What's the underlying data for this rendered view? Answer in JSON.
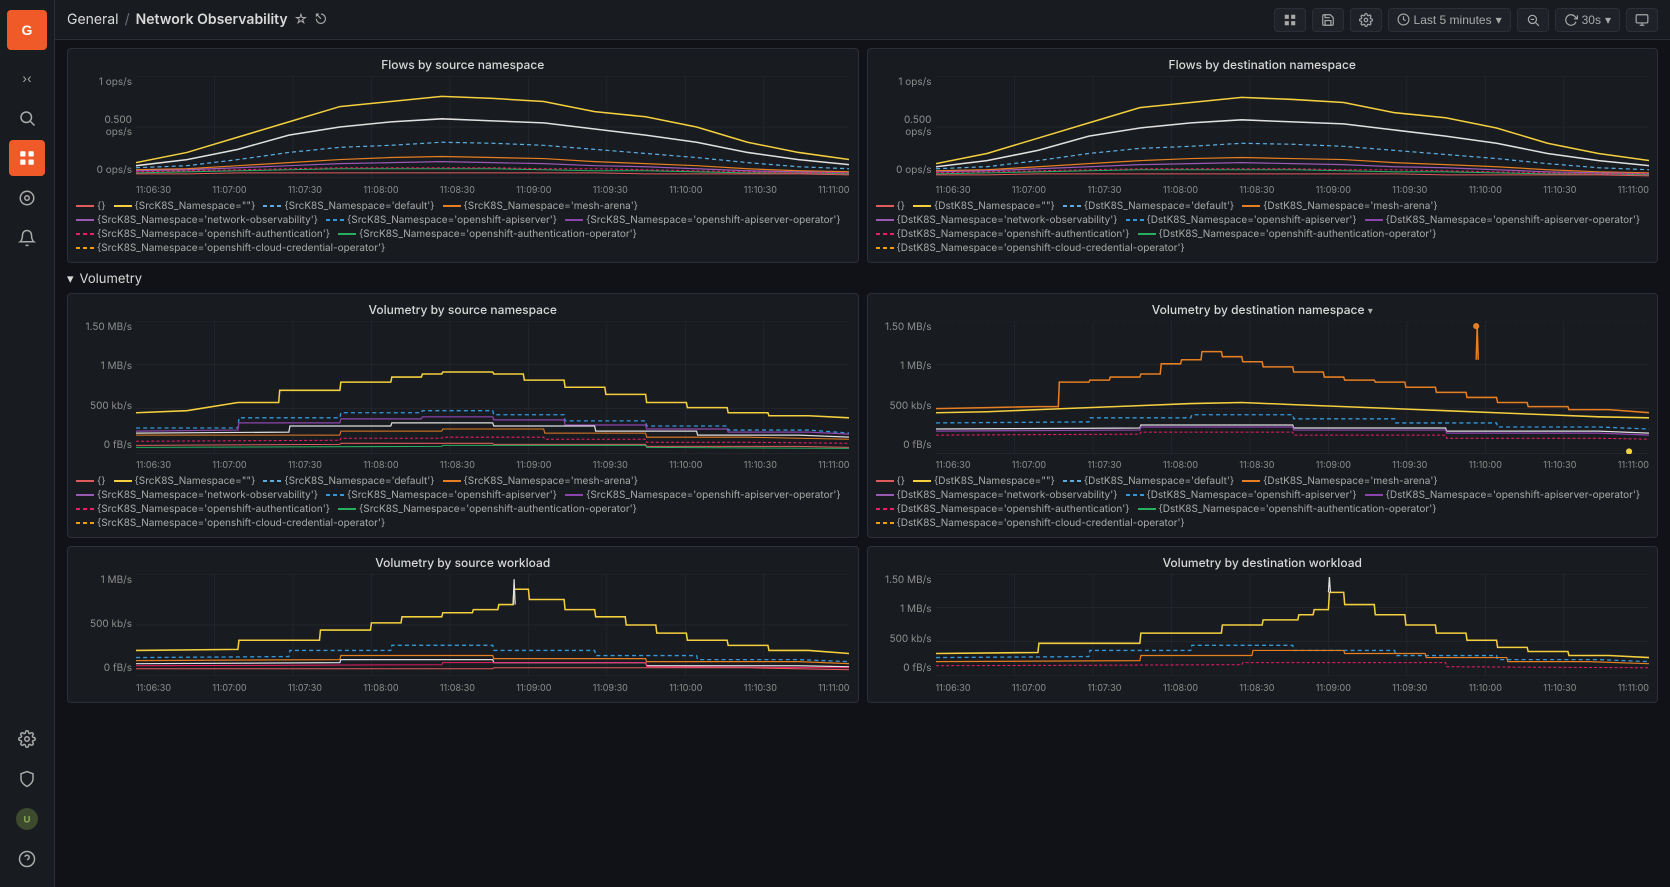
{
  "app": {
    "logo_text": "G",
    "breadcrumb_general": "General",
    "breadcrumb_sep": "/",
    "breadcrumb_title": "Network Observability"
  },
  "topbar": {
    "time_range": "Last 5 minutes",
    "refresh_interval": "30s"
  },
  "sidebar": {
    "items": [
      {
        "id": "search",
        "icon": "🔍",
        "label": "Search"
      },
      {
        "id": "dashboards",
        "icon": "⊞",
        "label": "Dashboards",
        "active": true
      },
      {
        "id": "explore",
        "icon": "◎",
        "label": "Explore"
      },
      {
        "id": "alerting",
        "icon": "🔔",
        "label": "Alerting"
      },
      {
        "id": "settings",
        "icon": "⚙",
        "label": "Settings"
      },
      {
        "id": "shield",
        "icon": "🛡",
        "label": "Shield"
      },
      {
        "id": "user",
        "icon": "👤",
        "label": "User"
      },
      {
        "id": "help",
        "icon": "?",
        "label": "Help"
      }
    ]
  },
  "section_volumetry": "Volumetry",
  "panels": {
    "flows_src": {
      "title": "Flows by source namespace",
      "y_labels": [
        "1 ops/s",
        "0.500 ops/s",
        "0 ops/s"
      ],
      "x_labels": [
        "11:06:30",
        "11:07:00",
        "11:07:30",
        "11:08:00",
        "11:08:30",
        "11:09:00",
        "11:09:30",
        "11:10:00",
        "11:10:30",
        "11:11:00"
      ],
      "legend": [
        {
          "color": "#e05c5c",
          "dash": false,
          "label": "{}"
        },
        {
          "color": "#f4d03f",
          "dash": false,
          "label": "{SrcK8S_Namespace=\"\"}"
        },
        {
          "color": "#5dade2",
          "dash": true,
          "label": "{SrcK8S_Namespace='default'}"
        },
        {
          "color": "#e67e22",
          "dash": false,
          "label": "{SrcK8S_Namespace='mesh-arena'}"
        },
        {
          "color": "#9b59b6",
          "dash": false,
          "label": "{SrcK8S_Namespace='network-observability'}"
        },
        {
          "color": "#3498db",
          "dash": true,
          "label": "{SrcK8S_Namespace='openshift-apiserver'}"
        },
        {
          "color": "#8e44ad",
          "dash": false,
          "label": "{SrcK8S_Namespace='openshift-apiserver-operator'}"
        },
        {
          "color": "#e91e63",
          "dash": true,
          "label": "{SrcK8S_Namespace='openshift-authentication'}"
        },
        {
          "color": "#27ae60",
          "dash": false,
          "label": "{SrcK8S_Namespace='openshift-authentication-operator'}"
        },
        {
          "color": "#f39c12",
          "dash": true,
          "label": "{SrcK8S_Namespace='openshift-cloud-credential-operator'}"
        }
      ]
    },
    "flows_dst": {
      "title": "Flows by destination namespace",
      "y_labels": [
        "1 ops/s",
        "0.500 ops/s",
        "0 ops/s"
      ],
      "x_labels": [
        "11:06:30",
        "11:07:00",
        "11:07:30",
        "11:08:00",
        "11:08:30",
        "11:09:00",
        "11:09:30",
        "11:10:00",
        "11:10:30",
        "11:11:00"
      ],
      "legend": [
        {
          "color": "#e05c5c",
          "dash": false,
          "label": "{}"
        },
        {
          "color": "#f4d03f",
          "dash": false,
          "label": "{DstK8S_Namespace=\"\"}"
        },
        {
          "color": "#5dade2",
          "dash": true,
          "label": "{DstK8S_Namespace='default'}"
        },
        {
          "color": "#e67e22",
          "dash": false,
          "label": "{DstK8S_Namespace='mesh-arena'}"
        },
        {
          "color": "#9b59b6",
          "dash": false,
          "label": "{DstK8S_Namespace='network-observability'}"
        },
        {
          "color": "#3498db",
          "dash": true,
          "label": "{DstK8S_Namespace='openshift-apiserver'}"
        },
        {
          "color": "#8e44ad",
          "dash": false,
          "label": "{DstK8S_Namespace='openshift-apiserver-operator'}"
        },
        {
          "color": "#e91e63",
          "dash": true,
          "label": "{DstK8S_Namespace='openshift-authentication'}"
        },
        {
          "color": "#27ae60",
          "dash": false,
          "label": "{DstK8S_Namespace='openshift-authentication-operator'}"
        },
        {
          "color": "#f39c12",
          "dash": true,
          "label": "{DstK8S_Namespace='openshift-cloud-credential-operator'}"
        }
      ]
    },
    "vol_src": {
      "title": "Volumetry by source namespace",
      "y_labels": [
        "1.50 MB/s",
        "1 MB/s",
        "500 kb/s",
        "0 fB/s"
      ],
      "x_labels": [
        "11:06:30",
        "11:07:00",
        "11:07:30",
        "11:08:00",
        "11:08:30",
        "11:09:00",
        "11:09:30",
        "11:10:00",
        "11:10:30",
        "11:11:00"
      ],
      "legend": [
        {
          "color": "#e05c5c",
          "dash": false,
          "label": "{}"
        },
        {
          "color": "#f4d03f",
          "dash": false,
          "label": "{SrcK8S_Namespace=\"\"}"
        },
        {
          "color": "#5dade2",
          "dash": true,
          "label": "{SrcK8S_Namespace='default'}"
        },
        {
          "color": "#e67e22",
          "dash": false,
          "label": "{SrcK8S_Namespace='mesh-arena'}"
        },
        {
          "color": "#9b59b6",
          "dash": false,
          "label": "{SrcK8S_Namespace='network-observability'}"
        },
        {
          "color": "#3498db",
          "dash": true,
          "label": "{SrcK8S_Namespace='openshift-apiserver'}"
        },
        {
          "color": "#8e44ad",
          "dash": false,
          "label": "{SrcK8S_Namespace='openshift-apiserver-operator'}"
        },
        {
          "color": "#e91e63",
          "dash": true,
          "label": "{SrcK8S_Namespace='openshift-authentication'}"
        },
        {
          "color": "#27ae60",
          "dash": false,
          "label": "{SrcK8S_Namespace='openshift-authentication-operator'}"
        },
        {
          "color": "#f39c12",
          "dash": true,
          "label": "{SrcK8S_Namespace='openshift-cloud-credential-operator'}"
        }
      ]
    },
    "vol_dst": {
      "title": "Volumetry by destination namespace",
      "y_labels": [
        "1.50 MB/s",
        "1 MB/s",
        "500 kb/s",
        "0 fB/s"
      ],
      "x_labels": [
        "11:06:30",
        "11:07:00",
        "11:07:30",
        "11:08:00",
        "11:08:30",
        "11:09:00",
        "11:09:30",
        "11:10:00",
        "11:10:30",
        "11:11:00"
      ],
      "legend": [
        {
          "color": "#e05c5c",
          "dash": false,
          "label": "{}"
        },
        {
          "color": "#f4d03f",
          "dash": false,
          "label": "{DstK8S_Namespace=\"\"}"
        },
        {
          "color": "#5dade2",
          "dash": true,
          "label": "{DstK8S_Namespace='default'}"
        },
        {
          "color": "#e67e22",
          "dash": false,
          "label": "{DstK8S_Namespace='mesh-arena'}"
        },
        {
          "color": "#9b59b6",
          "dash": false,
          "label": "{DstK8S_Namespace='network-observability'}"
        },
        {
          "color": "#3498db",
          "dash": true,
          "label": "{DstK8S_Namespace='openshift-apiserver'}"
        },
        {
          "color": "#8e44ad",
          "dash": false,
          "label": "{DstK8S_Namespace='openshift-apiserver-operator'}"
        },
        {
          "color": "#e91e63",
          "dash": true,
          "label": "{DstK8S_Namespace='openshift-authentication'}"
        },
        {
          "color": "#27ae60",
          "dash": false,
          "label": "{DstK8S_Namespace='openshift-authentication-operator'}"
        },
        {
          "color": "#f39c12",
          "dash": true,
          "label": "{DstK8S_Namespace='openshift-cloud-credential-operator'}"
        }
      ]
    },
    "vol_src_wl": {
      "title": "Volumetry by source workload",
      "y_labels": [
        "1 MB/s",
        "500 kb/s",
        "0 fB/s"
      ],
      "x_labels": [
        "11:06:30",
        "11:07:00",
        "11:07:30",
        "11:08:00",
        "11:08:30",
        "11:09:00",
        "11:09:30",
        "11:10:00",
        "11:10:30",
        "11:11:00"
      ]
    },
    "vol_dst_wl": {
      "title": "Volumetry by destination workload",
      "y_labels": [
        "1.50 MB/s",
        "1 MB/s",
        "500 kb/s",
        "0 fB/s"
      ],
      "x_labels": [
        "11:06:30",
        "11:07:00",
        "11:07:30",
        "11:08:00",
        "11:08:30",
        "11:09:00",
        "11:09:30",
        "11:10:00",
        "11:10:30",
        "11:11:00"
      ]
    }
  }
}
